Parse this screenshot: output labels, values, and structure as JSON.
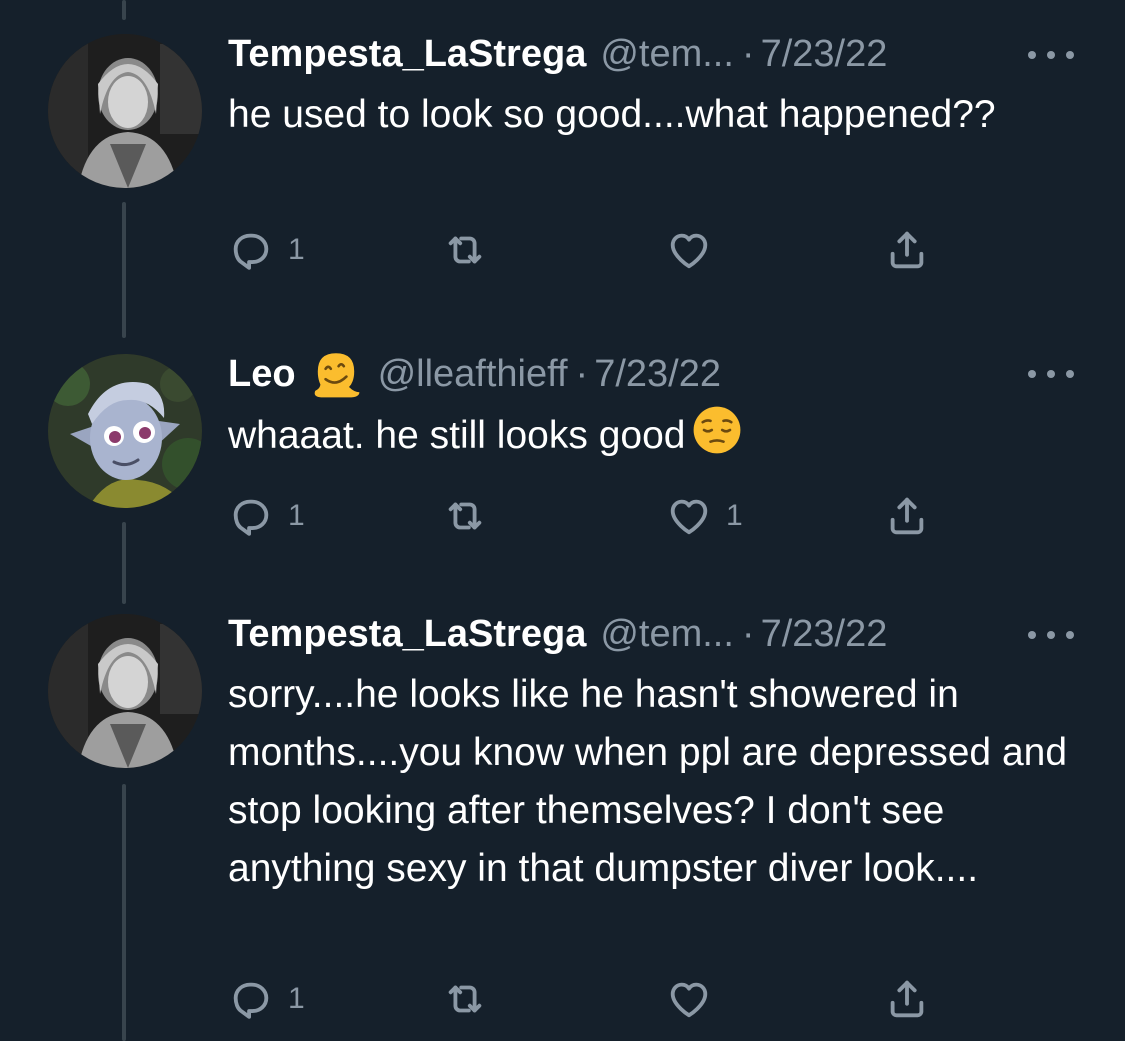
{
  "theme": {
    "background": "#15202b",
    "secondary_text": "#8b98a5",
    "thread_line": "#38444d"
  },
  "tweets": [
    {
      "name": "Tempesta_LaStrega",
      "handle": "@tem...",
      "separator": "·",
      "date": "7/23/22",
      "name_emoji": "",
      "text": "he used to look so good....what happened??",
      "text_emoji": "",
      "reply_count": "1",
      "retweet_count": "",
      "like_count": "",
      "avatar_icon": "avatar-grayscale-woman-photo"
    },
    {
      "name": "Leo",
      "handle": "@lleafthieff",
      "separator": "·",
      "date": "7/23/22",
      "name_emoji": "melting-face-emoji",
      "text": "whaaat. he still looks good",
      "text_emoji": "pensive-face-emoji",
      "reply_count": "1",
      "retweet_count": "",
      "like_count": "1",
      "avatar_icon": "avatar-cartoon-elf-character"
    },
    {
      "name": "Tempesta_LaStrega",
      "handle": "@tem...",
      "separator": "·",
      "date": "7/23/22",
      "name_emoji": "",
      "text": "sorry....he looks like he hasn't showered in months....you know when ppl are depressed and stop looking after themselves? I don't see anything sexy in that dumpster diver look....",
      "text_emoji": "",
      "reply_count": "1",
      "retweet_count": "",
      "like_count": "",
      "avatar_icon": "avatar-grayscale-woman-photo"
    }
  ]
}
